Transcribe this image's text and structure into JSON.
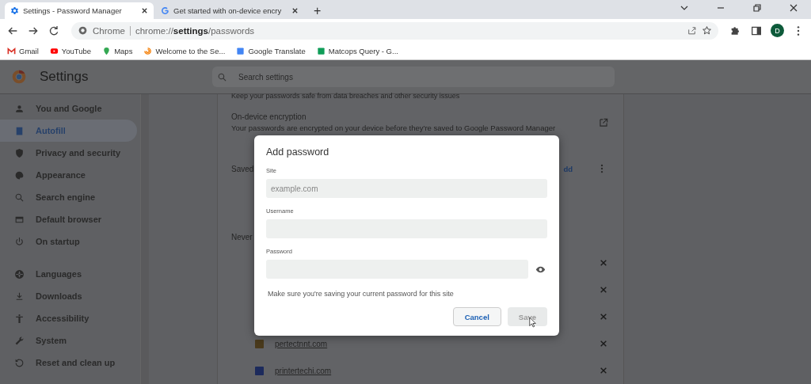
{
  "browser": {
    "tabs": [
      {
        "title": "Settings - Password Manager",
        "selected": true
      },
      {
        "title": "Get started with on-device encry",
        "selected": false
      }
    ],
    "new_tab": "+",
    "address": {
      "label": "Chrome",
      "url": "chrome://**settings**/passwords"
    },
    "profile": "D",
    "bookmarks": [
      "Gmail",
      "YouTube",
      "Maps",
      "Welcome to the Se...",
      "Google Translate",
      "Matcops Query - G..."
    ]
  },
  "settings": {
    "title": "Settings",
    "search": {
      "placeholder": "Search settings"
    },
    "nav": [
      {
        "label": "You and Google",
        "selected": false
      },
      {
        "label": "Autofill",
        "selected": true
      },
      {
        "label": "Privacy and security",
        "selected": false
      },
      {
        "label": "Appearance",
        "selected": false
      },
      {
        "label": "Search engine",
        "selected": false
      },
      {
        "label": "Default browser",
        "selected": false
      },
      {
        "label": "On startup",
        "selected": false
      },
      {
        "label": "Languages",
        "selected": false
      },
      {
        "label": "Downloads",
        "selected": false
      },
      {
        "label": "Accessibility",
        "selected": false
      },
      {
        "label": "System",
        "selected": false
      },
      {
        "label": "Reset and clean up",
        "selected": false
      }
    ],
    "cut_line": "Keep your passwords safe from data breaches and other security issues",
    "encryption": {
      "title": "On-device encryption",
      "description": "Your passwords are encrypted on your device before they're saved to Google Password Manager"
    },
    "saved_heading": "Saved",
    "add_link": "dd",
    "never_heading": "Never",
    "never_sites": [
      "pertectnnt.com",
      "printertechi.com"
    ]
  },
  "dialog": {
    "title": "Add password",
    "fields": [
      {
        "label": "Site",
        "placeholder": "example.com",
        "kind": "text"
      },
      {
        "label": "Username",
        "kind": "text"
      },
      {
        "label": "Password",
        "kind": "password"
      }
    ],
    "note": "Make sure you're saving your current password for this site",
    "buttons": [
      {
        "label": "Cancel",
        "kind": "secondary",
        "disabled": false
      },
      {
        "label": "Save",
        "kind": "primary",
        "disabled": true
      }
    ]
  }
}
